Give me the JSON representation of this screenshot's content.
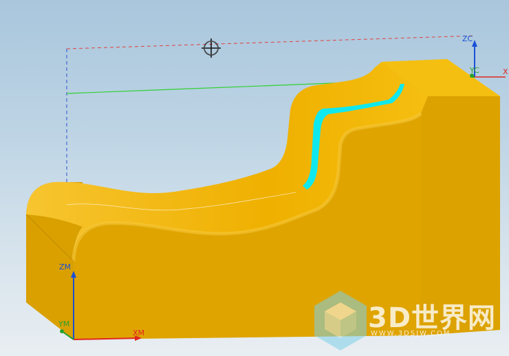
{
  "viewport": {
    "axes": {
      "zc_label": "ZC",
      "yc_label": "YC",
      "xc_label": "X",
      "zm_label": "ZM",
      "ym_label": "YM",
      "xm_label": "XM"
    },
    "colors": {
      "part_top": "#f2b400",
      "part_front": "#dfa300",
      "part_side": "#c48e00",
      "highlight_face": "#00e6f0",
      "x_axis": "#e0261f",
      "y_axis": "#2da02d",
      "z_axis": "#1a4fd6"
    }
  },
  "watermark": {
    "title": "3D世界网",
    "url": "WWW.3DSJW.COM"
  }
}
